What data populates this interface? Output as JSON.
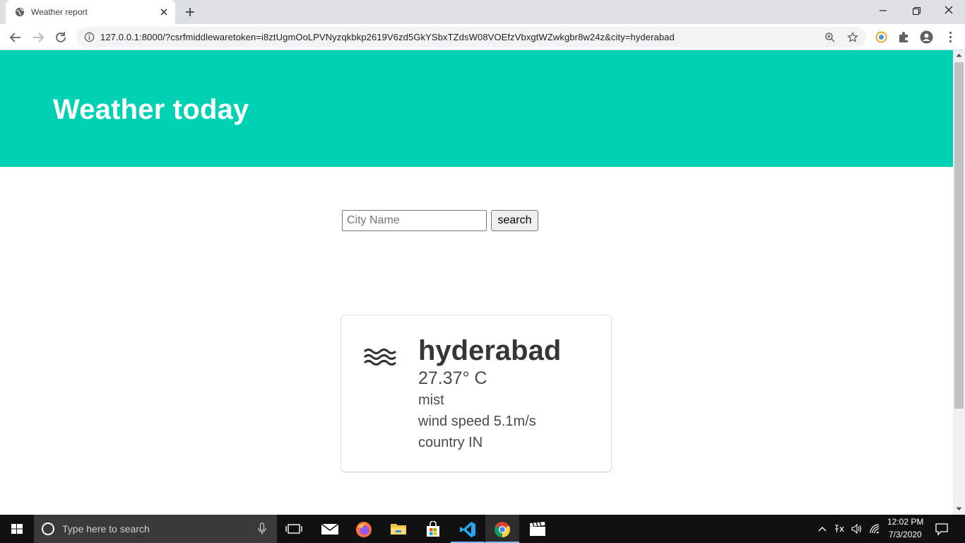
{
  "browser": {
    "tab_title": "Weather report",
    "url": "127.0.0.1:8000/?csrfmiddlewaretoken=i8ztUgmOoLPVNyzqkbkp2619V6zd5GkYSbxTZdsW08VOEfzVbxgtWZwkgbr8w24z&city=hyderabad"
  },
  "page": {
    "title": "Weather today",
    "search": {
      "placeholder": "City Name",
      "value": "",
      "button_label": "search"
    },
    "weather": {
      "city": "hyderabad",
      "temperature": "27.37° C",
      "description": "mist",
      "wind": "wind speed 5.1m/s",
      "country": "country IN",
      "icon": "mist-icon"
    }
  },
  "taskbar": {
    "search_placeholder": "Type here to search",
    "time": "12:02 PM",
    "date": "7/3/2020",
    "apps": [
      "task-view",
      "mail",
      "firefox",
      "file-explorer",
      "microsoft-store",
      "vscode",
      "chrome",
      "video-editor"
    ]
  },
  "colors": {
    "hero": "#00d1b2",
    "title_text": "#ffffff",
    "card_text": "#4a4a4a",
    "city_text": "#363636"
  }
}
